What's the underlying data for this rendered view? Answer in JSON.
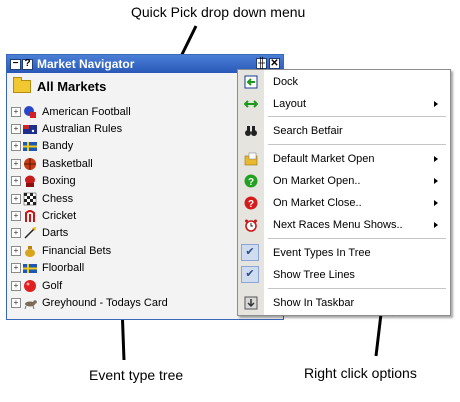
{
  "annotations": {
    "quick_pick": "Quick Pick drop down menu",
    "event_tree": "Event type tree",
    "right_click": "Right click options"
  },
  "window": {
    "title": "Market Navigator",
    "minimize_glyph": "−",
    "help_glyph": "?",
    "pin_glyph": "╫",
    "close_glyph": "✕"
  },
  "root": {
    "label": "All Markets",
    "icon": "folder-icon"
  },
  "tree": [
    {
      "label": "American Football",
      "icon": "american-football-icon",
      "expander": "+"
    },
    {
      "label": "Australian Rules",
      "icon": "australia-flag-icon",
      "expander": "+"
    },
    {
      "label": "Bandy",
      "icon": "sweden-flag-icon",
      "expander": "+"
    },
    {
      "label": "Basketball",
      "icon": "basketball-icon",
      "expander": "+"
    },
    {
      "label": "Boxing",
      "icon": "boxing-glove-icon",
      "expander": "+"
    },
    {
      "label": "Chess",
      "icon": "chessboard-icon",
      "expander": "+"
    },
    {
      "label": "Cricket",
      "icon": "cricket-stumps-icon",
      "expander": "+"
    },
    {
      "label": "Darts",
      "icon": "dart-icon",
      "expander": "+"
    },
    {
      "label": "Financial Bets",
      "icon": "money-bag-icon",
      "expander": "+"
    },
    {
      "label": "Floorball",
      "icon": "sweden-flag-icon",
      "expander": "+"
    },
    {
      "label": "Golf",
      "icon": "golf-ball-icon",
      "expander": "+"
    },
    {
      "label": "Greyhound - Todays Card",
      "icon": "greyhound-icon",
      "expander": "+"
    }
  ],
  "context_menu": [
    {
      "label": "Dock",
      "icon": "dock-arrow-icon",
      "submenu": false
    },
    {
      "label": "Layout",
      "icon": "layout-arrows-icon",
      "submenu": true
    },
    {
      "label": "Search Betfair",
      "icon": "binoculars-icon",
      "submenu": false
    },
    {
      "label": "Default Market Open",
      "icon": "folder-open-icon",
      "submenu": true
    },
    {
      "label": "On Market Open..",
      "icon": "green-question-icon",
      "submenu": true
    },
    {
      "label": "On Market Close..",
      "icon": "red-question-icon",
      "submenu": true
    },
    {
      "label": "Next Races Menu Shows..",
      "icon": "alarm-clock-icon",
      "submenu": true
    },
    {
      "label": "Event Types In Tree",
      "icon": "checkmark-icon",
      "checked": true,
      "submenu": false
    },
    {
      "label": "Show Tree Lines",
      "icon": "checkmark-icon",
      "checked": true,
      "submenu": false
    },
    {
      "label": "Show In Taskbar",
      "icon": "taskbar-icon",
      "submenu": false
    }
  ],
  "colors": {
    "title_bar": "#2958b8",
    "menu_gutter": "#e6e4de",
    "checked_bg": "#cfdcf0"
  }
}
